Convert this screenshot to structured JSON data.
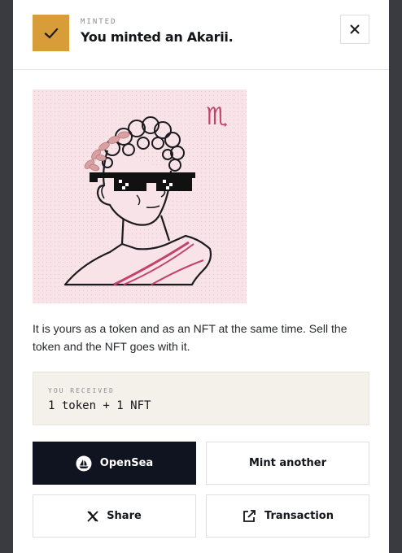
{
  "header": {
    "status_icon": "checkmark-icon",
    "eyebrow": "MINTED",
    "title": "You minted an Akarii.",
    "close_icon": "close-icon"
  },
  "nft_image": {
    "zodiac_glyph": "♏",
    "colors": {
      "background": "#f7e3e8",
      "accent": "#c2436e",
      "laurel": "#d8a1a1",
      "line": "#1b1b1f"
    }
  },
  "description": "It is yours as a token and as an NFT at the same time. Sell the token and the NFT goes with it.",
  "received": {
    "label": "YOU RECEIVED",
    "value": "1 token + 1 NFT"
  },
  "actions": {
    "opensea": {
      "label": "OpenSea",
      "icon": "opensea-icon"
    },
    "mint_another": {
      "label": "Mint another"
    },
    "share": {
      "label": "Share",
      "icon": "x-logo-icon"
    },
    "transaction": {
      "label": "Transaction",
      "icon": "external-link-icon"
    }
  },
  "colors": {
    "accent": "#d89c38",
    "primary_button": "#101420",
    "backdrop": "#3a3b40"
  }
}
